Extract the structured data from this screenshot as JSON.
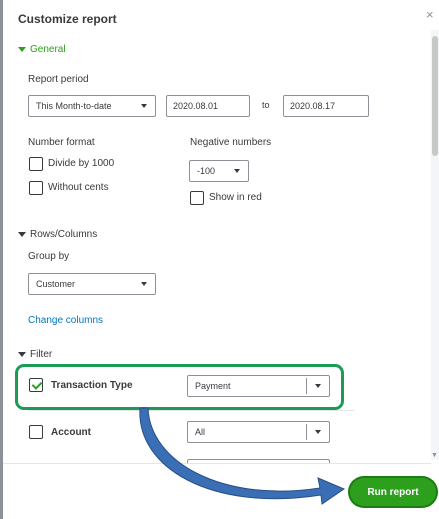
{
  "dialog": {
    "title": "Customize report",
    "close_glyph": "×"
  },
  "general": {
    "section_label": "General",
    "report_period": {
      "label": "Report period",
      "selected": "This Month-to-date",
      "from": "2020.08.01",
      "to_label": "to",
      "to": "2020.08.17"
    },
    "number_format": {
      "label": "Number format",
      "divide_by_1000": "Divide by 1000",
      "without_cents": "Without cents"
    },
    "negative_numbers": {
      "label": "Negative numbers",
      "selected": "-100",
      "show_in_red": "Show in red"
    }
  },
  "rows_columns": {
    "section_label": "Rows/Columns",
    "group_by_label": "Group by",
    "group_by_selected": "Customer",
    "change_columns": "Change columns"
  },
  "filter": {
    "section_label": "Filter",
    "transaction_type": {
      "label": "Transaction Type",
      "checked": true,
      "selected": "Payment"
    },
    "account": {
      "label": "Account",
      "checked": false,
      "selected": "All"
    }
  },
  "footer": {
    "run_report": "Run report"
  },
  "colors": {
    "accent_green": "#2ca01c",
    "link_blue": "#0077c5",
    "highlight_green": "#1b9c55",
    "arrow_blue": "#3a6fb5"
  },
  "icons": [
    "close-icon",
    "caret-down-icon",
    "checkmark-icon",
    "dropdown-arrow-icon",
    "curved-arrow-icon"
  ]
}
